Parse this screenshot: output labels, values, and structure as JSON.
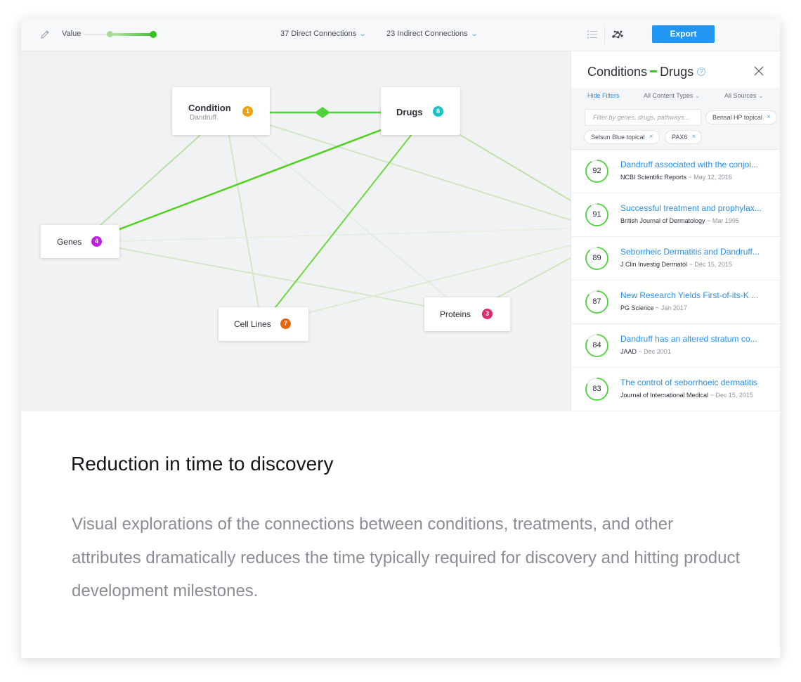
{
  "toolbar": {
    "value_label": "Value",
    "value_range": [
      0.38,
      1.0
    ],
    "direct_connections": "37 Direct Connections",
    "indirect_connections": "23 Indirect Connections",
    "export_label": "Export",
    "icons": [
      "pencil-icon",
      "list-view-icon",
      "graph-view-icon",
      "chevron-down-icon"
    ]
  },
  "graph": {
    "nodes": [
      {
        "id": "condition",
        "label": "Condition",
        "sublabel": "Dandruff",
        "count": "1",
        "color": "#f2a20f"
      },
      {
        "id": "drugs",
        "label": "Drugs",
        "count": "8",
        "color": "#17c2c2"
      },
      {
        "id": "genes",
        "label": "Genes",
        "count": "4",
        "color": "#c21fe6"
      },
      {
        "id": "cell_lines",
        "label": "Cell Lines",
        "count": "7",
        "color": "#e8630e"
      },
      {
        "id": "proteins",
        "label": "Proteins",
        "count": "3",
        "color": "#e02a6e"
      }
    ],
    "edges": [
      {
        "from": "condition",
        "to": "drugs",
        "strength": "selected"
      },
      {
        "from": "drugs",
        "to": "genes",
        "strength": "strong"
      },
      {
        "from": "drugs",
        "to": "cell_lines",
        "strength": "strong"
      },
      {
        "from": "condition",
        "to": "genes",
        "strength": "medium"
      },
      {
        "from": "condition",
        "to": "cell_lines",
        "strength": "weak"
      },
      {
        "from": "condition",
        "to": "proteins",
        "strength": "faint"
      },
      {
        "from": "condition",
        "to": "panel",
        "strength": "weak"
      },
      {
        "from": "drugs",
        "to": "panel",
        "strength": "medium"
      },
      {
        "from": "genes",
        "to": "proteins",
        "strength": "weak"
      },
      {
        "from": "genes",
        "to": "panel",
        "strength": "faint"
      },
      {
        "from": "cell_lines",
        "to": "panel",
        "strength": "faint"
      },
      {
        "from": "proteins",
        "to": "panel",
        "strength": "weak"
      }
    ],
    "colors": {
      "selected": "#4fd33c",
      "strong": "#5fd62b",
      "medium": "#b6e0a0",
      "weak": "#d2e7c4",
      "faint": "#e2ecdb"
    }
  },
  "panel": {
    "title_left": "Conditions",
    "title_right": "Drugs",
    "help_glyph": "?",
    "hide_filters": "Hide Filters",
    "content_types": "All Content Types",
    "sources": "All Sources",
    "filter_placeholder": "Filter by genes, drugs, pathways...",
    "chips": [
      "Bensal HP topical",
      "Selsun Blue topical",
      "PAX6"
    ],
    "results": [
      {
        "score": "92",
        "title": "Dandruff associated with the conjoi...",
        "source": "NCBI Scientific Reports",
        "date": "~ May 12, 2016"
      },
      {
        "score": "91",
        "title": "Successful treatment and prophylax...",
        "source": "British Journal of Dermatology",
        "date": "~ Mar 1995"
      },
      {
        "score": "89",
        "title": "Seborrheic Dermatitis and Dandruff...",
        "source": "J Clin Investig Dermatol",
        "date": "~ Dec 15, 2015"
      },
      {
        "score": "87",
        "title": "New Research Yields First-of-its-K ...",
        "source": "PG Science",
        "date": "~ Jan 2017"
      },
      {
        "score": "84",
        "title": "Dandruff has an altered stratum co...",
        "source": "JAAD",
        "date": "~ Dec 2001"
      },
      {
        "score": "83",
        "title": "The control of seborrhoeic dermatitis",
        "source": "Journal of International Medical",
        "date": "~ Dec 15, 2015"
      }
    ],
    "ring_color": "#4fd33c",
    "close_icon": "close-icon"
  },
  "caption": {
    "title": "Reduction in time to discovery",
    "body": "Visual explorations of the connections between conditions, treatments, and other attributes dramatically reduces the time typically required for discovery and hitting product development milestones."
  },
  "accent_color": "#2196f3"
}
